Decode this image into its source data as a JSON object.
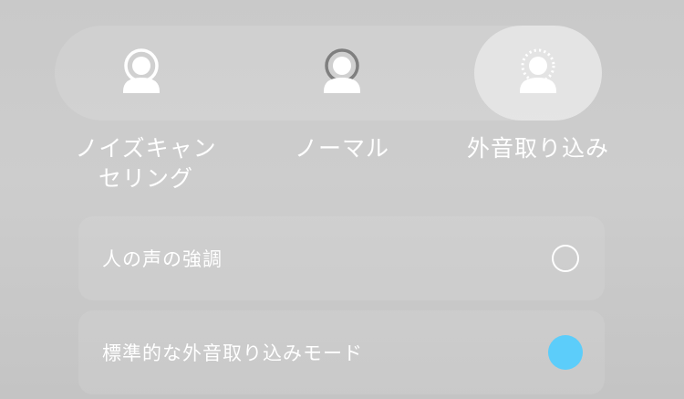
{
  "modes": [
    {
      "label": "ノイズキャン\nセリング",
      "icon": "noise-cancelling-person-icon",
      "selected": false
    },
    {
      "label": "ノーマル",
      "icon": "normal-person-icon",
      "selected": false
    },
    {
      "label": "外音取り込み",
      "icon": "ambient-sound-person-icon",
      "selected": true
    }
  ],
  "options": [
    {
      "label": "人の声の強調",
      "checked": false
    },
    {
      "label": "標準的な外音取り込みモード",
      "checked": true
    }
  ],
  "colors": {
    "accent": "#5ccdfa",
    "text": "#ffffff"
  }
}
